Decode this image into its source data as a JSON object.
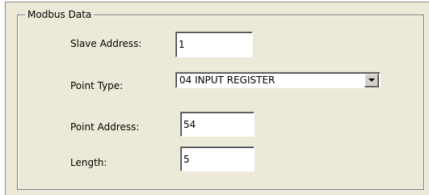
{
  "group": {
    "title": "Modbus Data"
  },
  "fields": {
    "slave_address": {
      "label": "Slave Address:",
      "value": "1"
    },
    "point_type": {
      "label": "Point Type:",
      "value": "04 INPUT REGISTER"
    },
    "point_address": {
      "label": "Point Address:",
      "value": "54"
    },
    "length": {
      "label": "Length:",
      "value": "5"
    }
  },
  "icons": {
    "dropdown": "chevron-down-icon"
  }
}
